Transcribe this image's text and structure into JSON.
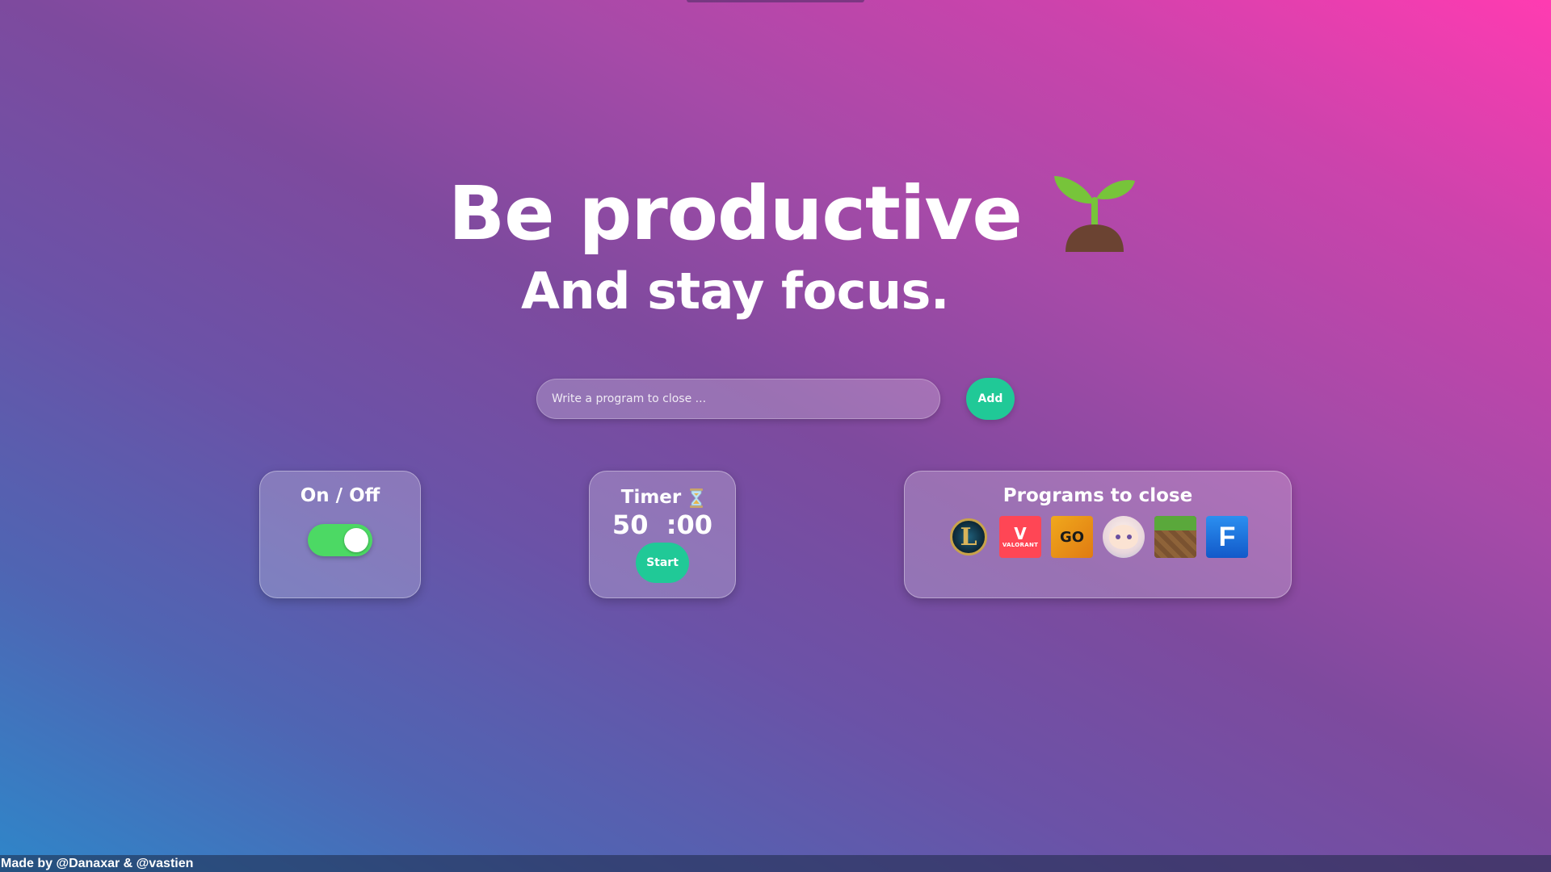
{
  "hero": {
    "title": "Be productive",
    "title_icon": "sprout-icon",
    "subtitle": "And stay focus."
  },
  "add_program": {
    "placeholder": "Write a program to close ...",
    "value": "",
    "button_label": "Add"
  },
  "on_off": {
    "title": "On / Off",
    "enabled": true,
    "toggle_color": "#4cd964"
  },
  "timer": {
    "title": "Timer",
    "icon": "hourglass-icon",
    "minutes": "50",
    "seconds": ":00",
    "start_label": "Start"
  },
  "programs": {
    "title": "Programs to close",
    "items": [
      {
        "name": "League of Legends",
        "icon": "league-of-legends-icon"
      },
      {
        "name": "Valorant",
        "icon": "valorant-icon",
        "text": "VALORANT"
      },
      {
        "name": "CS:GO",
        "icon": "csgo-icon",
        "text": "GO"
      },
      {
        "name": "Genshin Impact",
        "icon": "genshin-impact-icon"
      },
      {
        "name": "Minecraft",
        "icon": "minecraft-icon"
      },
      {
        "name": "Fortnite",
        "icon": "fortnite-icon",
        "text": "F"
      }
    ]
  },
  "footer": {
    "credit": "Made by @Danaxar & @vastien"
  },
  "colors": {
    "accent": "#20c997",
    "gradient_start": "#2f86c9",
    "gradient_end": "#ff3bb1"
  }
}
